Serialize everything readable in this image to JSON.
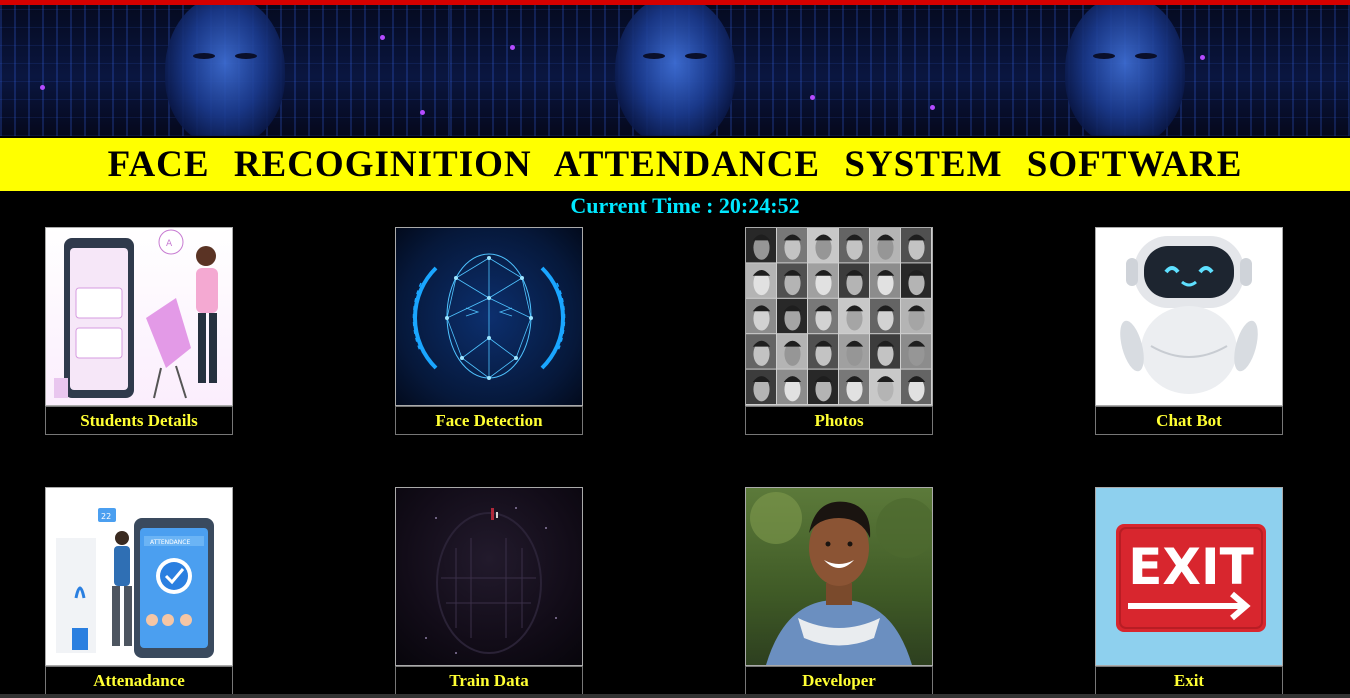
{
  "header": {
    "title": "FACE  RECOGINITION  ATTENDANCE  SYSTEM  SOFTWARE"
  },
  "clock": {
    "text": "Current Time : 20:24:52"
  },
  "tiles": [
    {
      "label": "Students Details",
      "icon": "students-illustration"
    },
    {
      "label": "Face Detection",
      "icon": "face-mesh-illustration"
    },
    {
      "label": "Photos",
      "icon": "photo-grid-illustration"
    },
    {
      "label": "Chat Bot",
      "icon": "robot-illustration"
    },
    {
      "label": "Attenadance",
      "icon": "attendance-phone-illustration"
    },
    {
      "label": "Train Data",
      "icon": "ai-head-illustration"
    },
    {
      "label": "Developer",
      "icon": "developer-photo"
    },
    {
      "label": "Exit",
      "icon": "exit-sign-illustration"
    }
  ],
  "exit_sign_text": "EXIT",
  "colors": {
    "title_bar": "#ffff00",
    "label_text": "#ffff33",
    "clock_text": "#00e8ff",
    "top_line": "#d40000",
    "background": "#000000"
  }
}
